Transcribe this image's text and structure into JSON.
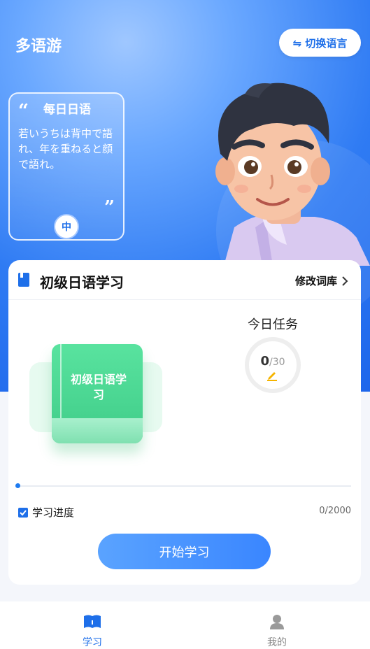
{
  "header": {
    "app_title": "多语游",
    "switch_language_label": "⇋ 切换语言"
  },
  "daily_quote": {
    "title": "每日日语",
    "text": "若いうちは背中で語れ、年を重ねると顔で語れ。",
    "open_mark": "“",
    "close_mark": "”",
    "translate_label": "中"
  },
  "study_card": {
    "title": "初级日语学习",
    "edit_label": "修改词库",
    "book_label": "初级日语学习",
    "today_task_title": "今日任务",
    "task_done": "0",
    "task_total": "/30",
    "progress_label": "学习进度",
    "progress_count": "0/2000",
    "start_button": "开始学习"
  },
  "tabbar": {
    "study": "学习",
    "mine": "我的"
  },
  "colors": {
    "primary": "#1e6fe9",
    "book_green": "#3fcc88",
    "pencil_yellow": "#f5b400",
    "inactive": "#888888"
  }
}
